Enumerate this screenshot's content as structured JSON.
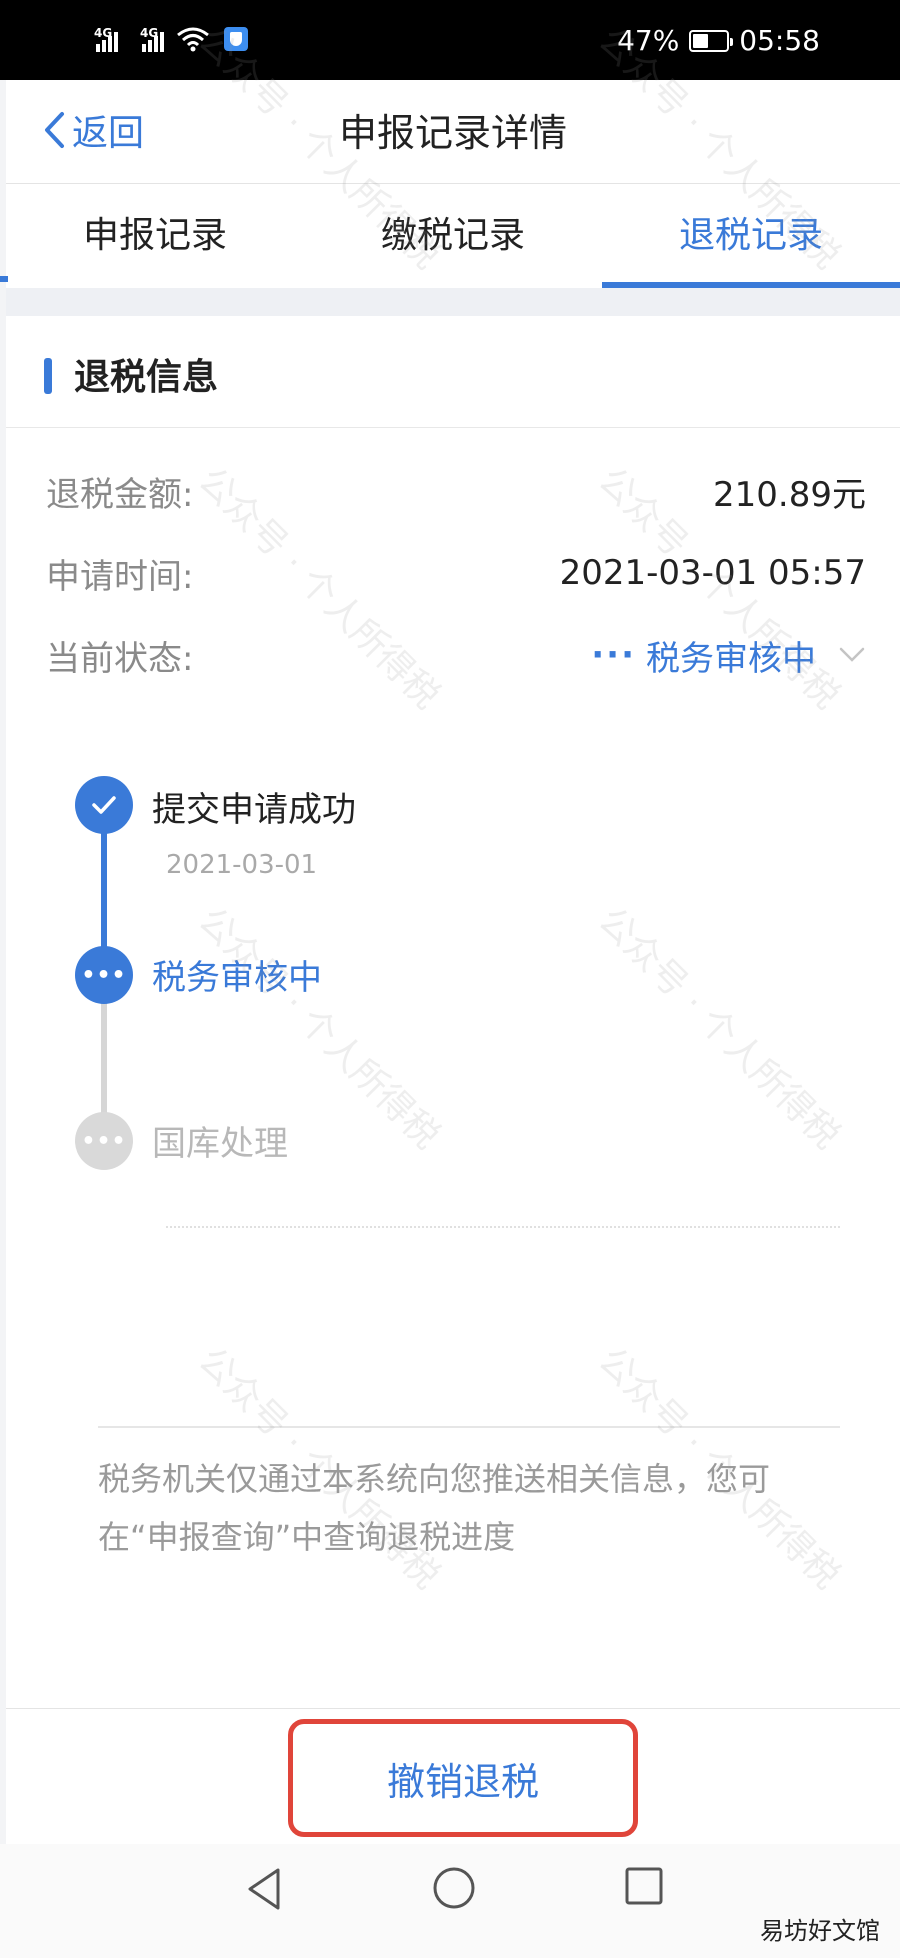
{
  "status_bar": {
    "signal_1": "4G",
    "signal_2": "4G",
    "battery_percent": "47%",
    "battery_level": 0.47,
    "time": "05:58"
  },
  "header": {
    "back_label": "返回",
    "title": "申报记录详情"
  },
  "tabs": [
    {
      "label": "申报记录",
      "active": false
    },
    {
      "label": "缴税记录",
      "active": false
    },
    {
      "label": "退税记录",
      "active": true
    }
  ],
  "section": {
    "title": "退税信息"
  },
  "info": {
    "amount_label": "退税金额:",
    "amount_value": "210.89元",
    "time_label": "申请时间:",
    "time_value": "2021-03-01 05:57",
    "status_label": "当前状态:",
    "status_dots": "···",
    "status_value": "税务审核中"
  },
  "timeline": [
    {
      "label": "提交申请成功",
      "date": "2021-03-01",
      "state": "done"
    },
    {
      "label": "税务审核中",
      "state": "current"
    },
    {
      "label": "国库处理",
      "state": "pending"
    }
  ],
  "notice": "税务机关仅通过本系统向您推送相关信息，您可在“申报查询”中查询退税进度",
  "bottom": {
    "cancel_label": "撤销退税"
  },
  "watermark": "公众号 · 个人所得税",
  "credit": "易坊好文馆",
  "colors": {
    "accent": "#3a7ad8",
    "highlight_border": "#e0453a",
    "pending": "#d9d9d9"
  }
}
